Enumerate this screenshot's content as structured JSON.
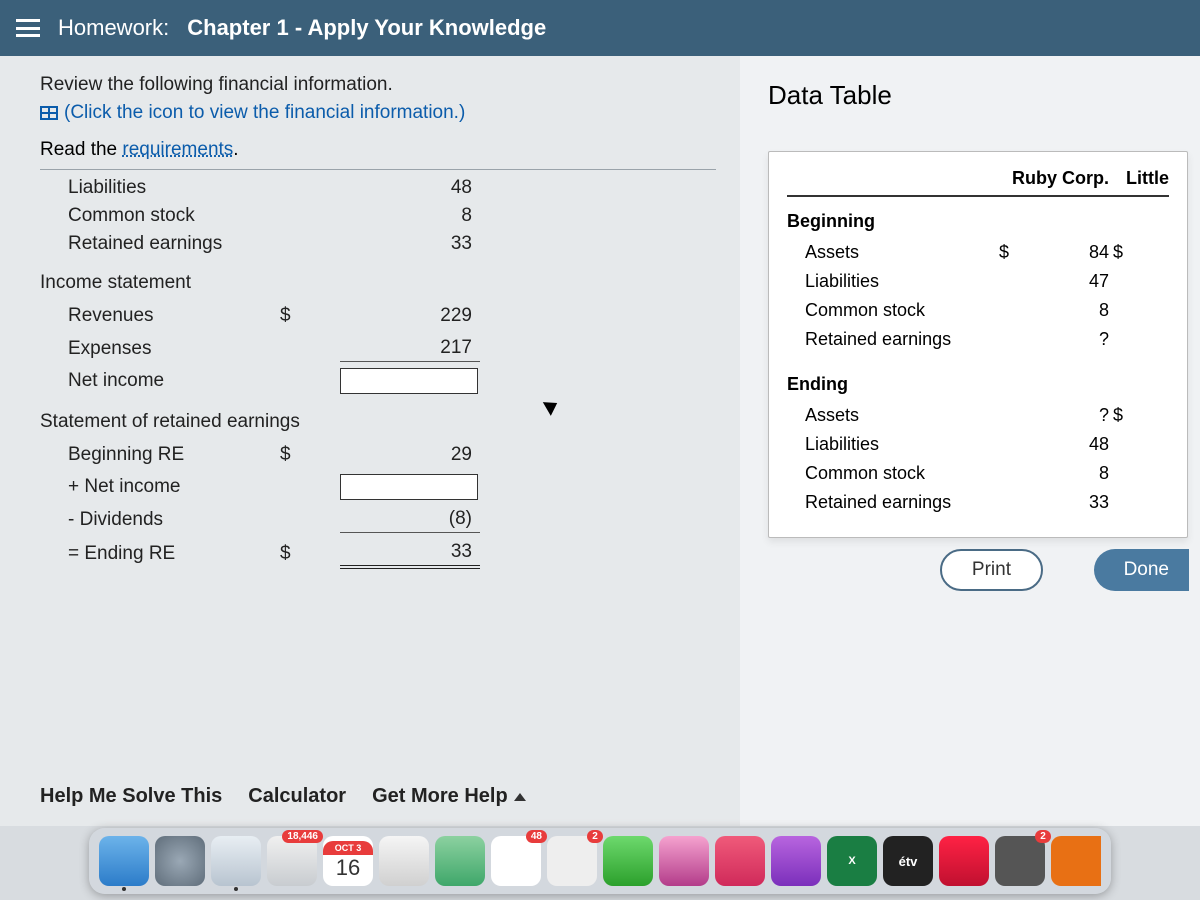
{
  "header": {
    "prefix": "Homework:",
    "title": "Chapter 1 - Apply Your Knowledge"
  },
  "instructions": {
    "line1": "Review the following financial information.",
    "line2": "(Click the icon to view the financial information.)",
    "read_req_prefix": "Read the ",
    "read_req_link": "requirements"
  },
  "worksheet": {
    "balance": {
      "liabilities": {
        "label": "Liabilities",
        "value": "48"
      },
      "common_stock": {
        "label": "Common stock",
        "value": "8"
      },
      "retained_earnings": {
        "label": "Retained earnings",
        "value": "33"
      }
    },
    "income": {
      "heading": "Income statement",
      "revenues": {
        "label": "Revenues",
        "currency": "$",
        "value": "229"
      },
      "expenses": {
        "label": "Expenses",
        "value": "217"
      },
      "net_income": {
        "label": "Net income"
      }
    },
    "sre": {
      "heading": "Statement of retained earnings",
      "beginning": {
        "label": "Beginning RE",
        "currency": "$",
        "value": "29"
      },
      "plus_ni": {
        "label": "+ Net income"
      },
      "dividends": {
        "label": "- Dividends",
        "value": "(8)"
      },
      "ending": {
        "label": "= Ending RE",
        "currency": "$",
        "value": "33"
      }
    }
  },
  "help": {
    "solve": "Help Me Solve This",
    "calc": "Calculator",
    "more": "Get More Help"
  },
  "data_table": {
    "title": "Data Table",
    "columns": {
      "company1": "Ruby Corp.",
      "company2": "Little"
    },
    "beginning": {
      "label": "Beginning",
      "assets": {
        "label": "Assets",
        "cur": "$",
        "v1": "84",
        "c2": "$"
      },
      "liabilities": {
        "label": "Liabilities",
        "v1": "47"
      },
      "common_stock": {
        "label": "Common stock",
        "v1": "8"
      },
      "retained_earnings": {
        "label": "Retained earnings",
        "v1": "?"
      }
    },
    "ending": {
      "label": "Ending",
      "assets": {
        "label": "Assets",
        "v1": "?",
        "c2": "$"
      },
      "liabilities": {
        "label": "Liabilities",
        "v1": "48"
      },
      "common_stock": {
        "label": "Common stock",
        "v1": "8"
      },
      "retained_earnings": {
        "label": "Retained earnings",
        "v1": "33"
      }
    },
    "buttons": {
      "print": "Print",
      "done": "Done"
    }
  },
  "dock": {
    "mail_badge": "18,446",
    "cal_month": "OCT 3",
    "cal_day": "16",
    "photos_badge": "48",
    "msg_badge": "2",
    "excel": "X",
    "tv": "étv",
    "set_badge": "2"
  }
}
